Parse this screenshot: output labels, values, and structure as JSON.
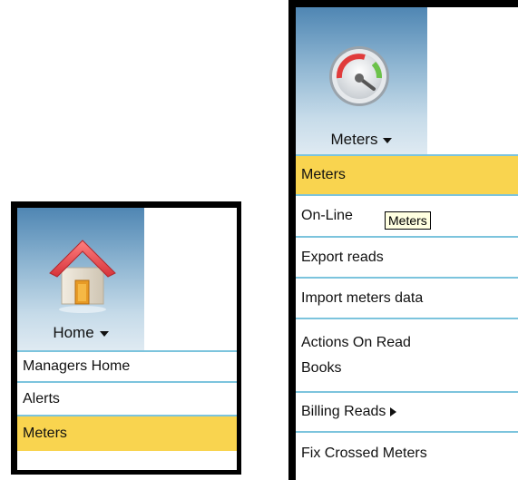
{
  "home_panel": {
    "menu_label": "Home",
    "icon": "home-icon",
    "items": [
      {
        "label": "Managers Home",
        "active": false
      },
      {
        "label": "Alerts",
        "active": false
      },
      {
        "label": "Meters",
        "active": true
      }
    ]
  },
  "meters_panel": {
    "menu_label": "Meters",
    "icon": "gauge-icon",
    "items": [
      {
        "label": "Meters",
        "active": true
      },
      {
        "label": "On-Line",
        "active": false
      },
      {
        "label": "Export reads",
        "active": false
      },
      {
        "label": "Import meters data",
        "active": false
      },
      {
        "label": "Actions On Read",
        "label2": "Books",
        "active": false
      },
      {
        "label": "Billing Reads",
        "active": false,
        "submenu": true
      },
      {
        "label": "Fix Crossed Meters",
        "active": false
      }
    ],
    "tooltip": "Meters"
  },
  "colors": {
    "highlight": "#f9d44f",
    "separator": "#7cc4dd",
    "header_top": "#4f86b3",
    "frame": "#000000"
  }
}
